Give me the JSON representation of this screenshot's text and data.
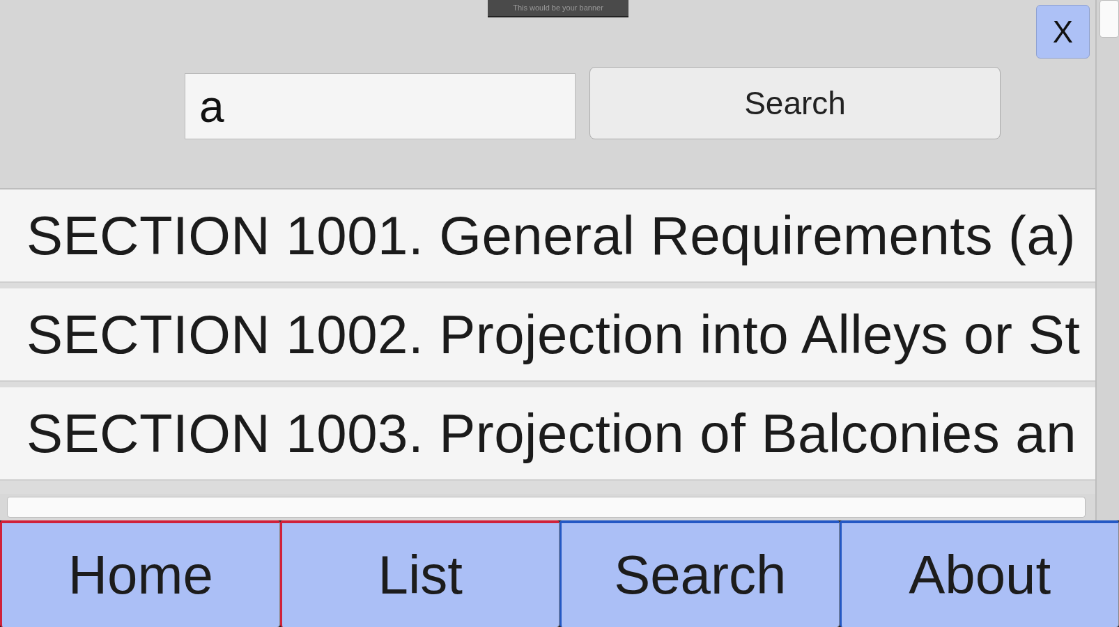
{
  "banner": {
    "text": "This would be your banner"
  },
  "close_button": {
    "label": "X"
  },
  "search": {
    "value": "a",
    "button": "Search"
  },
  "results": [
    {
      "title": "SECTION 1001. General Requirements (a)"
    },
    {
      "title": "SECTION 1002. Projection into Alleys or St"
    },
    {
      "title": "SECTION 1003. Projection of Balconies an"
    }
  ],
  "tabs": [
    {
      "label": "Home",
      "color": "#d0213a"
    },
    {
      "label": "List",
      "color": "#d0213a"
    },
    {
      "label": "Search",
      "color": "#2458c4"
    },
    {
      "label": "About",
      "color": "#2458c4"
    }
  ]
}
